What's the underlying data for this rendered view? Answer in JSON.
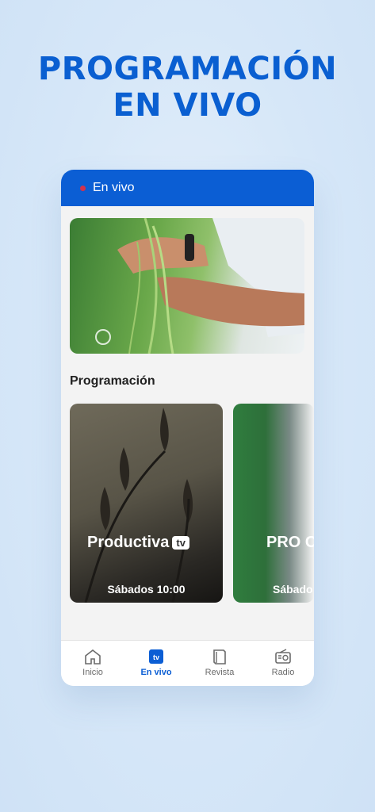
{
  "headline": {
    "line1": "PROGRAMACIÓN",
    "line2": "EN VIVO"
  },
  "topbar": {
    "title": "En vivo",
    "live_color": "#d3324d",
    "bg_color": "#0b5ed4"
  },
  "hero": {
    "image": "farmer-hands-bean-plants"
  },
  "programacion": {
    "title": "Programación",
    "cards": [
      {
        "logo": "Productiva",
        "badge": "tv",
        "time": "Sábados 10:00"
      },
      {
        "logo": "PRO CIE",
        "time": "Sábado"
      }
    ]
  },
  "nav": {
    "items": [
      {
        "label": "Inicio",
        "icon": "home-icon"
      },
      {
        "label": "En vivo",
        "icon": "tv-icon",
        "active": true
      },
      {
        "label": "Revista",
        "icon": "book-icon"
      },
      {
        "label": "Radio",
        "icon": "radio-icon"
      }
    ]
  }
}
